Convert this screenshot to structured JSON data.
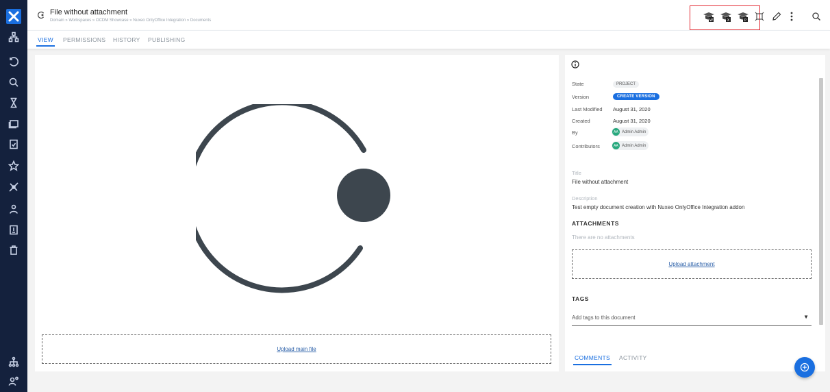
{
  "header": {
    "title": "File without attachment",
    "breadcrumb": "Domain » Workspaces » OCDM Showcase » Nuxeo OnlyOffice Integration » Documents"
  },
  "toolbar": {
    "actions": [
      {
        "name": "onlyoffice-word-icon",
        "badge": "W"
      },
      {
        "name": "onlyoffice-excel-icon",
        "badge": "X"
      },
      {
        "name": "onlyoffice-powerpoint-icon",
        "badge": "P"
      },
      {
        "name": "preview-icon"
      },
      {
        "name": "edit-icon"
      },
      {
        "name": "more-vertical-icon"
      },
      {
        "name": "search-icon"
      }
    ],
    "highlight_color": "#e2262f"
  },
  "tabs": [
    "VIEW",
    "PERMISSIONS",
    "HISTORY",
    "PUBLISHING"
  ],
  "viewer": {
    "upload_main": "Upload main file"
  },
  "metadata": {
    "state_label": "State",
    "state_value": "PROJECT",
    "version_label": "Version",
    "version_button": "CREATE VERSION",
    "modified_label": "Last Modified",
    "modified_value": "August 31, 2020",
    "created_label": "Created",
    "created_value": "August 31, 2020",
    "by_label": "By",
    "by_initials": "AA",
    "by_name": "Admin Admin",
    "contributors_label": "Contributors",
    "contributor_initials": "AA",
    "contributor_name": "Admin Admin",
    "title_label": "Title",
    "title_value": "File without attachment",
    "description_label": "Description",
    "description_value": "Test empty document creation with Nuxeo OnlyOffice Integration addon"
  },
  "attachments": {
    "heading": "ATTACHMENTS",
    "empty_text": "There are no attachments",
    "upload_link": "Upload attachment"
  },
  "tags": {
    "heading": "TAGS",
    "placeholder": "Add tags to this document"
  },
  "panel_tabs": [
    "COMMENTS",
    "ACTIVITY"
  ],
  "colors": {
    "accent": "#1a6fe0",
    "sidebar": "#14213d",
    "avatar": "#27a87d"
  }
}
